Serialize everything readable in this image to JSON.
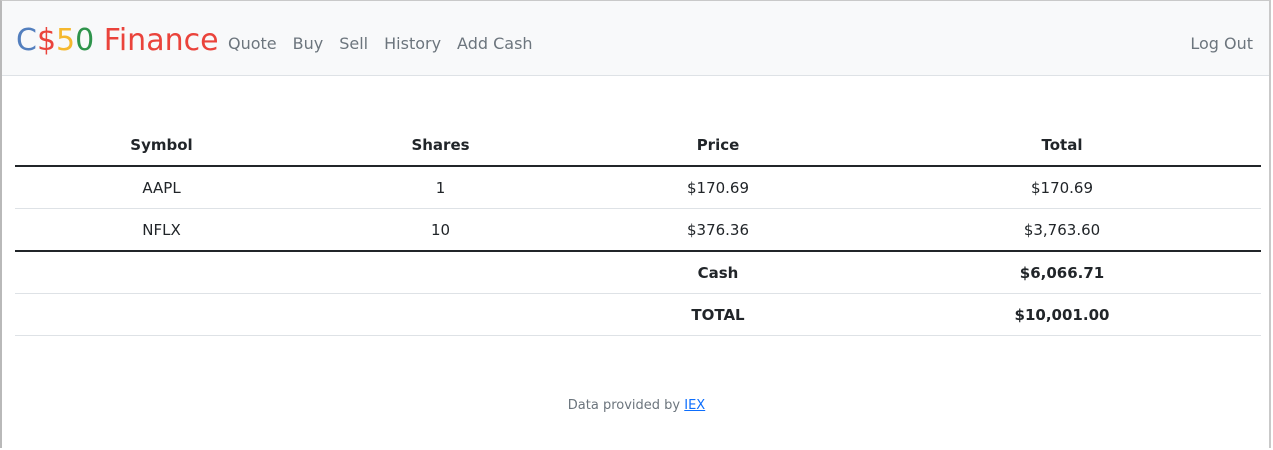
{
  "brand": {
    "c": "C",
    "dollar": "$",
    "five": "5",
    "zero": "0",
    "finance": " Finance"
  },
  "nav": {
    "items": [
      {
        "label": "Quote"
      },
      {
        "label": "Buy"
      },
      {
        "label": "Sell"
      },
      {
        "label": "History"
      },
      {
        "label": "Add Cash"
      }
    ],
    "logout": "Log Out"
  },
  "table": {
    "headers": [
      "Symbol",
      "Shares",
      "Price",
      "Total"
    ],
    "rows": [
      {
        "symbol": "AAPL",
        "shares": "1",
        "price": "$170.69",
        "total": "$170.69"
      },
      {
        "symbol": "NFLX",
        "shares": "10",
        "price": "$376.36",
        "total": "$3,763.60"
      }
    ],
    "cash_label": "Cash",
    "cash_value": "$6,066.71",
    "total_label": "TOTAL",
    "total_value": "$10,001.00"
  },
  "footer": {
    "prefix": "Data provided by ",
    "link": "IEX"
  },
  "colors": {
    "brand_blue": "#537fbe",
    "brand_red": "#ea433b",
    "brand_yellow": "#f5b82e",
    "brand_green": "#2e944b",
    "link": "#0d6efd",
    "nav_text": "#6c757d"
  }
}
